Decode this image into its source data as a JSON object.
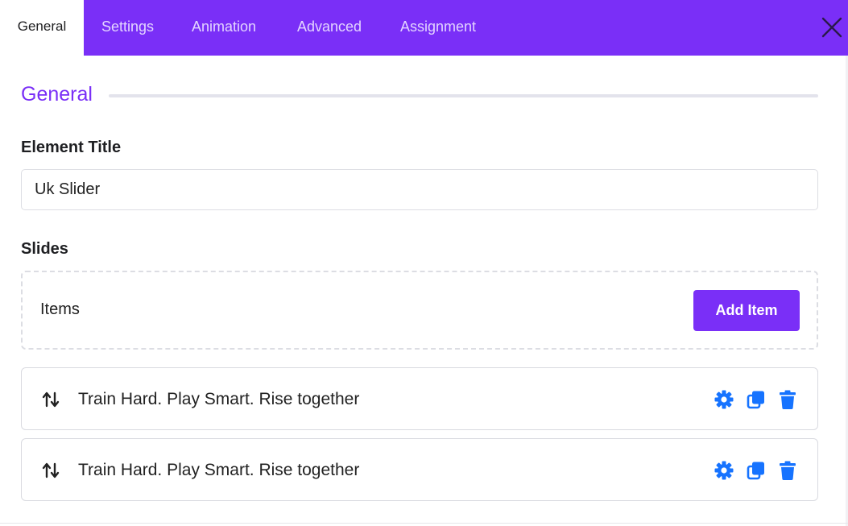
{
  "tabs": [
    {
      "label": "General",
      "active": true
    },
    {
      "label": "Settings",
      "active": false
    },
    {
      "label": "Animation",
      "active": false
    },
    {
      "label": "Advanced",
      "active": false
    },
    {
      "label": "Assignment",
      "active": false
    }
  ],
  "close_icon": "close-icon",
  "section": {
    "title": "General"
  },
  "element_title": {
    "label": "Element Title",
    "value": "Uk Slider"
  },
  "slides": {
    "label": "Slides",
    "items_label": "Items",
    "add_button": "Add Item",
    "rows": [
      {
        "text": "Train Hard. Play Smart. Rise together",
        "icons": [
          "sort-arrows-icon",
          "gear-icon",
          "copy-icon",
          "trash-icon"
        ]
      },
      {
        "text": "Train Hard. Play Smart. Rise together",
        "icons": [
          "sort-arrows-icon",
          "gear-icon",
          "copy-icon",
          "trash-icon"
        ]
      }
    ]
  },
  "colors": {
    "accent": "#7a2ff7",
    "action_icon": "#1673ff",
    "tab_inactive_text": "#e3d4ff"
  }
}
